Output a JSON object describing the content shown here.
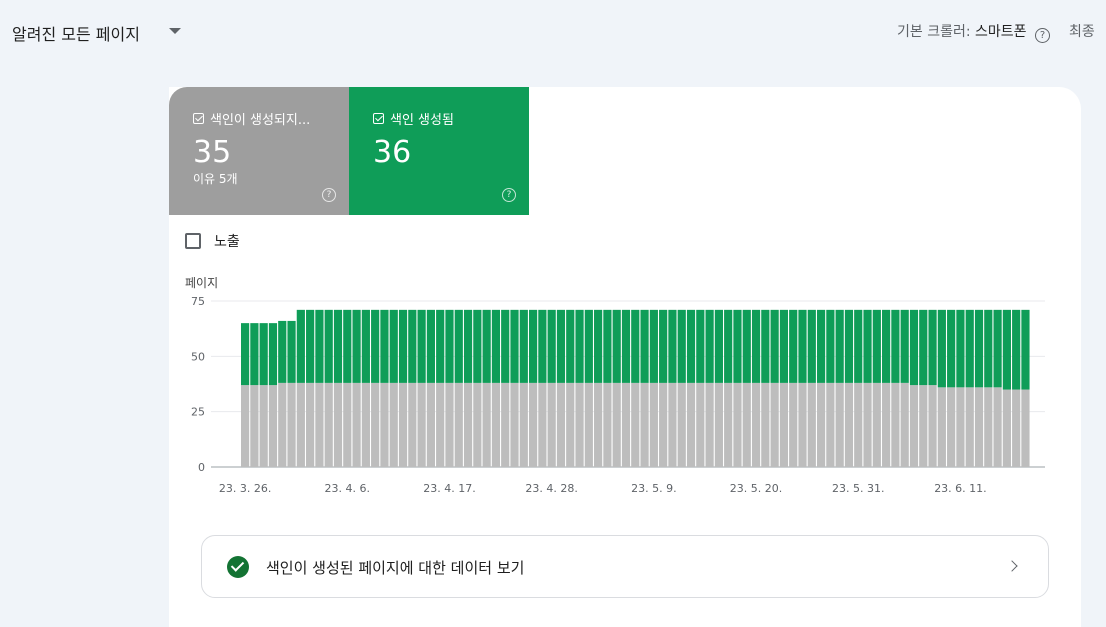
{
  "header": {
    "page_selector": "알려진 모든 페이지",
    "crawler_label": "기본 크롤러:",
    "crawler_value": "스마트폰",
    "latest_label": "최종"
  },
  "metrics": {
    "not_indexed": {
      "title": "색인이 생성되지...",
      "value": "35",
      "sub": "이유 5개",
      "color": "#9e9e9e"
    },
    "indexed": {
      "title": "색인 생성됨",
      "value": "36",
      "color": "#0f9d58"
    }
  },
  "impressions": {
    "label": "노출"
  },
  "link": {
    "text": "색인이 생성된 페이지에 대한 데이터 보기"
  },
  "chart_data": {
    "type": "bar",
    "stacked": true,
    "ylabel": "페이지",
    "ylim": [
      0,
      75
    ],
    "yticks": [
      "75",
      "50",
      "25",
      "0"
    ],
    "xtick_labels": [
      "23. 3. 26.",
      "23. 4. 6.",
      "23. 4. 17.",
      "23. 4. 28.",
      "23. 5. 9.",
      "23. 5. 20.",
      "23. 5. 31.",
      "23. 6. 11."
    ],
    "grid": true,
    "series": [
      {
        "name": "색인이 생성되지...",
        "color": "#bdbdbd",
        "values": [
          37,
          37,
          37,
          37,
          38,
          38,
          38,
          38,
          38,
          38,
          38,
          38,
          38,
          38,
          38,
          38,
          38,
          38,
          38,
          38,
          38,
          38,
          38,
          38,
          38,
          38,
          38,
          38,
          38,
          38,
          38,
          38,
          38,
          38,
          38,
          38,
          38,
          38,
          38,
          38,
          38,
          38,
          38,
          38,
          38,
          38,
          38,
          38,
          38,
          38,
          38,
          38,
          38,
          38,
          38,
          38,
          38,
          38,
          38,
          38,
          38,
          38,
          38,
          38,
          38,
          38,
          38,
          38,
          38,
          38,
          38,
          38,
          37,
          37,
          37,
          36,
          36,
          36,
          36,
          36,
          36,
          36,
          35,
          35,
          35
        ]
      },
      {
        "name": "색인 생성됨",
        "color": "#0f9d58",
        "values": [
          28,
          28,
          28,
          28,
          28,
          28,
          33,
          33,
          33,
          33,
          33,
          33,
          33,
          33,
          33,
          33,
          33,
          33,
          33,
          33,
          33,
          33,
          33,
          33,
          33,
          33,
          33,
          33,
          33,
          33,
          33,
          33,
          33,
          33,
          33,
          33,
          33,
          33,
          33,
          33,
          33,
          33,
          33,
          33,
          33,
          33,
          33,
          33,
          33,
          33,
          33,
          33,
          33,
          33,
          33,
          33,
          33,
          33,
          33,
          33,
          33,
          33,
          33,
          33,
          33,
          33,
          33,
          33,
          33,
          33,
          33,
          33,
          34,
          34,
          34,
          35,
          35,
          35,
          35,
          35,
          35,
          35,
          36,
          36,
          36
        ]
      }
    ]
  }
}
